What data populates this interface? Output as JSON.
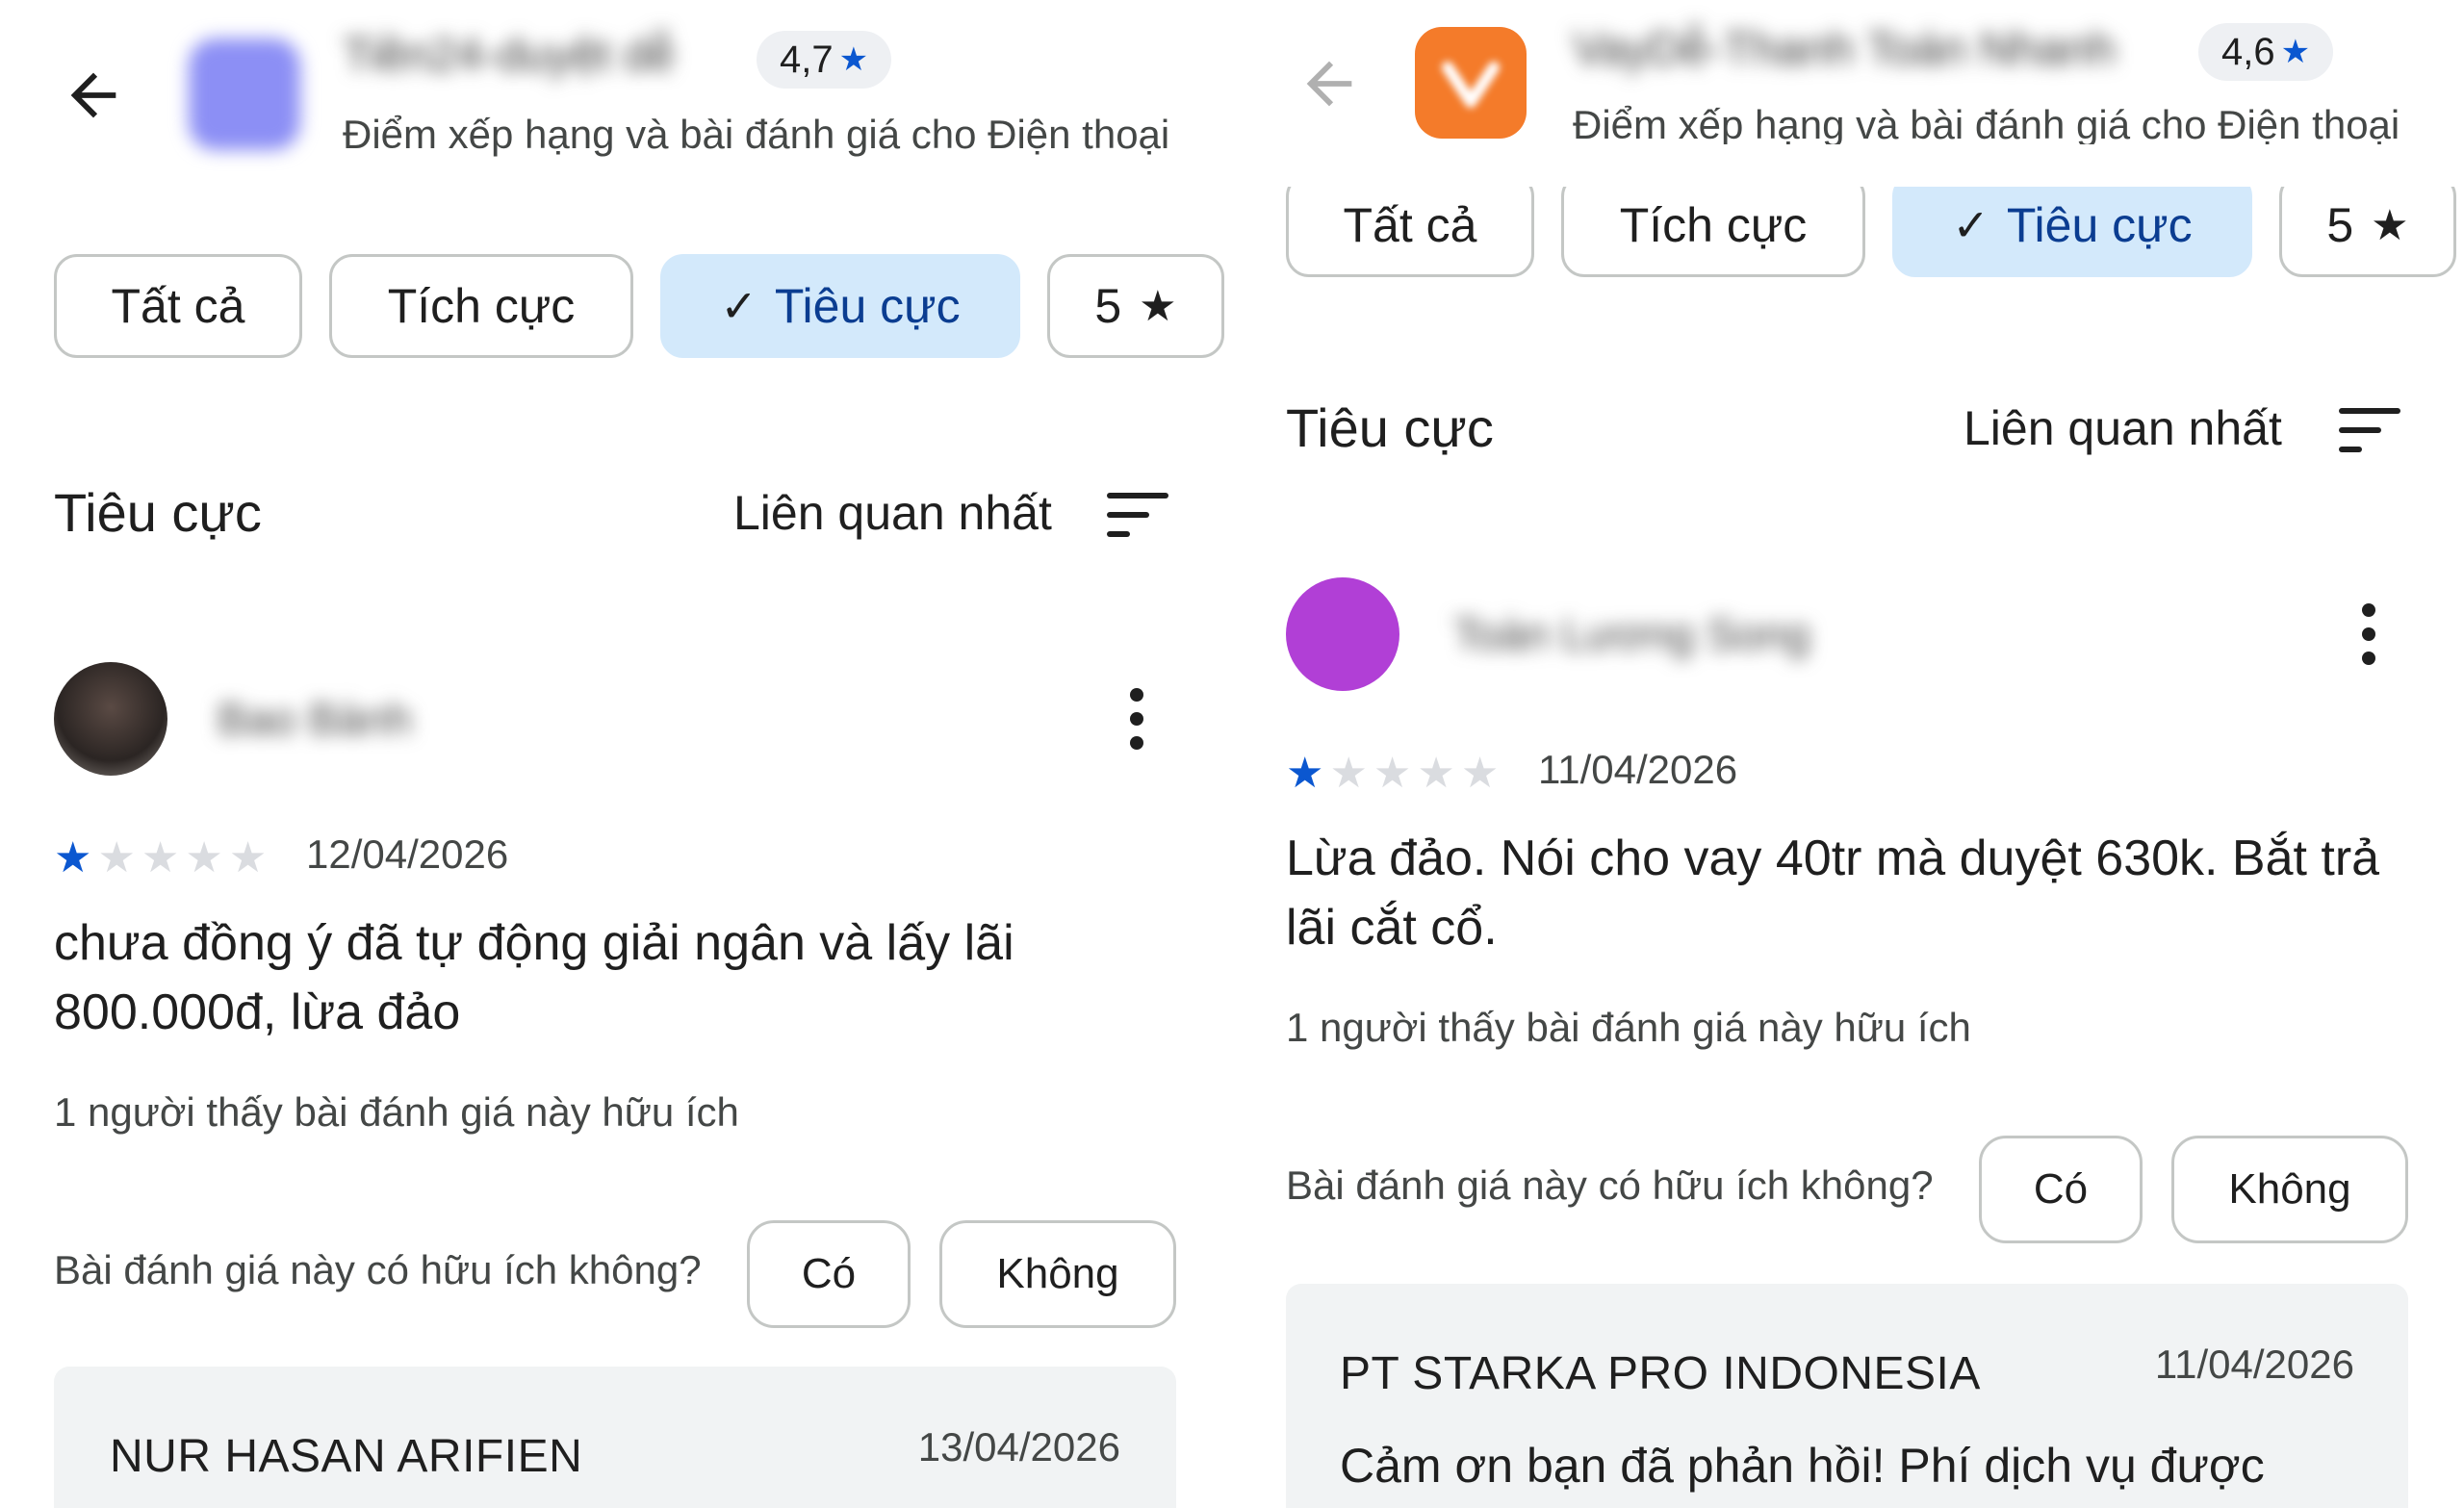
{
  "colors": {
    "accent_blue": "#0b57d0",
    "selected_chip_bg": "#d3e9fb",
    "reply_bg": "#f1f3f4",
    "left_app_icon": "#8c8ff5",
    "right_app_icon": "#f47b2a",
    "right_avatar": "#b13fd6"
  },
  "left": {
    "header": {
      "app_name": "Tiền24-duyệt dễ",
      "rating": "4,7",
      "subtitle": "Điểm xếp hạng và bài đánh giá cho Điện thoại"
    },
    "filters": {
      "all": "Tất cả",
      "positive": "Tích cực",
      "negative": "Tiêu cực",
      "five": "5"
    },
    "section": {
      "title": "Tiêu cực",
      "sort": "Liên quan nhất"
    },
    "review": {
      "author": "Bao Bành",
      "stars": 1,
      "date": "12/04/2026",
      "text": "chưa đồng ý đã tự động giải ngân và lấy lãi 800.000đ, lừa đảo",
      "helpful_count": "1 người thấy bài đánh giá này hữu ích",
      "helpful_question": "Bài đánh giá này có hữu ích không?",
      "yes": "Có",
      "no": "Không"
    },
    "reply": {
      "developer": "NUR HASAN ARIFIEN",
      "date": "13/04/2026"
    }
  },
  "right": {
    "header": {
      "app_name": "VayDễ-Thanh Toán Nhanh",
      "rating": "4,6",
      "subtitle": "Điểm xếp hạng và bài đánh giá cho Điện thoại"
    },
    "filters": {
      "all": "Tất cả",
      "positive": "Tích cực",
      "negative": "Tiêu cực",
      "five": "5"
    },
    "section": {
      "title": "Tiêu cực",
      "sort": "Liên quan nhất"
    },
    "review": {
      "author": "Toàn Lương Song",
      "stars": 1,
      "date": "11/04/2026",
      "text_line1": "Lừa đảo. Nói cho vay 40tr mà duyệt 630k. Bắt trả",
      "text_line2": "lãi cắt cổ.",
      "helpful_count": "1 người thấy bài đánh giá này hữu ích",
      "helpful_question": "Bài đánh giá này có hữu ích không?",
      "yes": "Có",
      "no": "Không"
    },
    "reply": {
      "developer": "PT STARKA PRO INDONESIA",
      "date": "11/04/2026",
      "text": "Cảm ơn bạn đã phản hồi! Phí dịch vụ được"
    }
  }
}
